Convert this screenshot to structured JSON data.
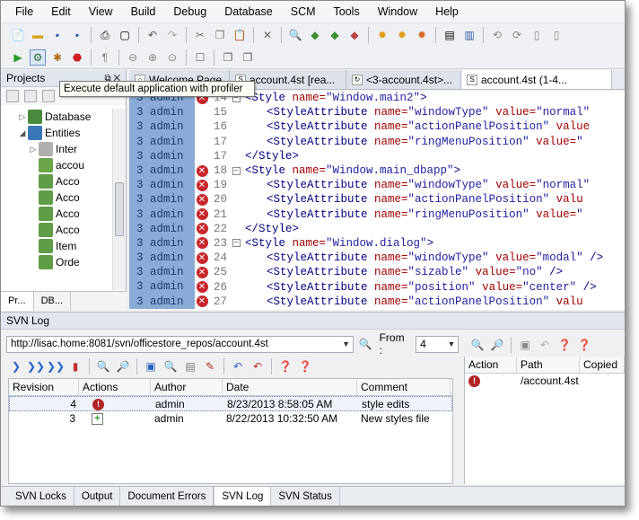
{
  "menu": [
    "File",
    "Edit",
    "View",
    "Build",
    "Debug",
    "Database",
    "SCM",
    "Tools",
    "Window",
    "Help"
  ],
  "tooltip": "Execute default application with profiler",
  "projects": {
    "title": "Projects",
    "tree": [
      {
        "label": "Database",
        "indent": 2,
        "arrow": "▷",
        "color": "#4a8a3c"
      },
      {
        "label": "Entities",
        "indent": 2,
        "arrow": "◢",
        "color": "#3a77b8"
      },
      {
        "label": "Inter",
        "indent": 3,
        "arrow": "▷",
        "color": "#b0b0b0"
      },
      {
        "label": "accou",
        "indent": 3,
        "arrow": "",
        "color": "#6aa54a"
      },
      {
        "label": "Acco",
        "indent": 3,
        "arrow": "",
        "color": "#5f9d47"
      },
      {
        "label": "Acco",
        "indent": 3,
        "arrow": "",
        "color": "#5f9d47"
      },
      {
        "label": "Acco",
        "indent": 3,
        "arrow": "",
        "color": "#5f9d47"
      },
      {
        "label": "Acco",
        "indent": 3,
        "arrow": "",
        "color": "#5f9d47"
      },
      {
        "label": "Item",
        "indent": 3,
        "arrow": "",
        "color": "#5f9d47"
      },
      {
        "label": "Orde",
        "indent": 3,
        "arrow": "",
        "color": "#5f9d47"
      }
    ],
    "tabs": [
      "Pr...",
      "DB..."
    ]
  },
  "editor": {
    "tabs": [
      "Welcome Page",
      "account.4st [rea...",
      "<3-account.4st>...",
      "account.4st (1-4..."
    ],
    "lines": [
      {
        "rev": "3",
        "author": "admin",
        "num": "14",
        "err": true,
        "fold": "⊟",
        "indent": 0,
        "parts": [
          [
            "tg",
            "<Style "
          ],
          [
            "an",
            "name="
          ],
          [
            "av",
            "\"Window.main2\""
          ],
          [
            "tg",
            ">"
          ]
        ]
      },
      {
        "rev": "3",
        "author": "admin",
        "num": "15",
        "err": false,
        "fold": "",
        "indent": 2,
        "parts": [
          [
            "tg",
            "<StyleAttribute "
          ],
          [
            "an",
            "name="
          ],
          [
            "av",
            "\"windowType\" "
          ],
          [
            "an",
            "value="
          ],
          [
            "av",
            "\"normal\""
          ]
        ]
      },
      {
        "rev": "3",
        "author": "admin",
        "num": "16",
        "err": false,
        "fold": "",
        "indent": 2,
        "parts": [
          [
            "tg",
            "<StyleAttribute "
          ],
          [
            "an",
            "name="
          ],
          [
            "av",
            "\"actionPanelPosition\" "
          ],
          [
            "an",
            "value"
          ]
        ]
      },
      {
        "rev": "3",
        "author": "admin",
        "num": "17",
        "err": false,
        "fold": "",
        "indent": 2,
        "parts": [
          [
            "tg",
            "<StyleAttribute "
          ],
          [
            "an",
            "name="
          ],
          [
            "av",
            "\"ringMenuPosition\" "
          ],
          [
            "an",
            "value="
          ],
          [
            "av",
            "\""
          ]
        ]
      },
      {
        "rev": "3",
        "author": "admin",
        "num": "17",
        "err": false,
        "fold": "",
        "indent": 0,
        "parts": [
          [
            "tg",
            "</Style>"
          ]
        ]
      },
      {
        "rev": "3",
        "author": "admin",
        "num": "18",
        "err": true,
        "fold": "⊟",
        "indent": 0,
        "parts": [
          [
            "tg",
            "<Style "
          ],
          [
            "an",
            "name="
          ],
          [
            "av",
            "\"Window.main_dbapp\""
          ],
          [
            "tg",
            ">"
          ]
        ]
      },
      {
        "rev": "3",
        "author": "admin",
        "num": "19",
        "err": true,
        "fold": "",
        "indent": 2,
        "parts": [
          [
            "tg",
            "<StyleAttribute "
          ],
          [
            "an",
            "name="
          ],
          [
            "av",
            "\"windowType\" "
          ],
          [
            "an",
            "value="
          ],
          [
            "av",
            "\"normal\""
          ]
        ]
      },
      {
        "rev": "3",
        "author": "admin",
        "num": "20",
        "err": true,
        "fold": "",
        "indent": 2,
        "parts": [
          [
            "tg",
            "<StyleAttribute "
          ],
          [
            "an",
            "name="
          ],
          [
            "av",
            "\"actionPanelPosition\" "
          ],
          [
            "an",
            "valu"
          ]
        ]
      },
      {
        "rev": "3",
        "author": "admin",
        "num": "21",
        "err": true,
        "fold": "",
        "indent": 2,
        "parts": [
          [
            "tg",
            "<StyleAttribute "
          ],
          [
            "an",
            "name="
          ],
          [
            "av",
            "\"ringMenuPosition\" "
          ],
          [
            "an",
            "value="
          ],
          [
            "av",
            "\""
          ]
        ]
      },
      {
        "rev": "3",
        "author": "admin",
        "num": "22",
        "err": true,
        "fold": "",
        "indent": 0,
        "parts": [
          [
            "tg",
            "</Style>"
          ]
        ]
      },
      {
        "rev": "3",
        "author": "admin",
        "num": "23",
        "err": true,
        "fold": "⊟",
        "indent": 0,
        "parts": [
          [
            "tg",
            "<Style "
          ],
          [
            "an",
            "name="
          ],
          [
            "av",
            "\"Window.dialog\""
          ],
          [
            "tg",
            ">"
          ]
        ]
      },
      {
        "rev": "3",
        "author": "admin",
        "num": "24",
        "err": true,
        "fold": "",
        "indent": 2,
        "parts": [
          [
            "tg",
            "<StyleAttribute "
          ],
          [
            "an",
            "name="
          ],
          [
            "av",
            "\"windowType\" "
          ],
          [
            "an",
            "value="
          ],
          [
            "av",
            "\"modal\" "
          ],
          [
            "tg",
            "/>"
          ]
        ]
      },
      {
        "rev": "3",
        "author": "admin",
        "num": "25",
        "err": true,
        "fold": "",
        "indent": 2,
        "parts": [
          [
            "tg",
            "<StyleAttribute "
          ],
          [
            "an",
            "name="
          ],
          [
            "av",
            "\"sizable\" "
          ],
          [
            "an",
            "value="
          ],
          [
            "av",
            "\"no\" "
          ],
          [
            "tg",
            "/>"
          ]
        ]
      },
      {
        "rev": "3",
        "author": "admin",
        "num": "26",
        "err": true,
        "fold": "",
        "indent": 2,
        "parts": [
          [
            "tg",
            "<StyleAttribute "
          ],
          [
            "an",
            "name="
          ],
          [
            "av",
            "\"position\" "
          ],
          [
            "an",
            "value="
          ],
          [
            "av",
            "\"center\" "
          ],
          [
            "tg",
            "/>"
          ]
        ]
      },
      {
        "rev": "3",
        "author": "admin",
        "num": "27",
        "err": true,
        "fold": "",
        "indent": 2,
        "parts": [
          [
            "tg",
            "<StyleAttribute "
          ],
          [
            "an",
            "name="
          ],
          [
            "av",
            "\"actionPanelPosition\" "
          ],
          [
            "an",
            "valu"
          ]
        ]
      }
    ]
  },
  "svn": {
    "title": "SVN Log",
    "url": "http://lisac.home:8081/svn/officestore_repos/account.4st",
    "from_label": "From :",
    "from_value": "4",
    "columns": [
      "Revision",
      "Actions",
      "Author",
      "Date",
      "Comment"
    ],
    "rows": [
      {
        "revision": "4",
        "action": "modified",
        "author": "admin",
        "date": "8/23/2013 8:58:05 AM",
        "comment": "style edits",
        "selected": true
      },
      {
        "revision": "3",
        "action": "added",
        "author": "admin",
        "date": "8/22/2013 10:32:50 AM",
        "comment": "New styles file",
        "selected": false
      }
    ],
    "path_columns": [
      "Action",
      "Path",
      "Copied"
    ],
    "paths": [
      {
        "path": "/account.4st"
      }
    ]
  },
  "bottom_tabs": [
    "SVN Locks",
    "Output",
    "Document Errors",
    "SVN Log",
    "SVN Status"
  ],
  "active_bottom_tab": "SVN Log",
  "colors": {
    "blame": "#8aabd6",
    "error": "#c8262b",
    "tag": "#00007f",
    "attr": "#a00000",
    "value": "#1f1fa0"
  }
}
